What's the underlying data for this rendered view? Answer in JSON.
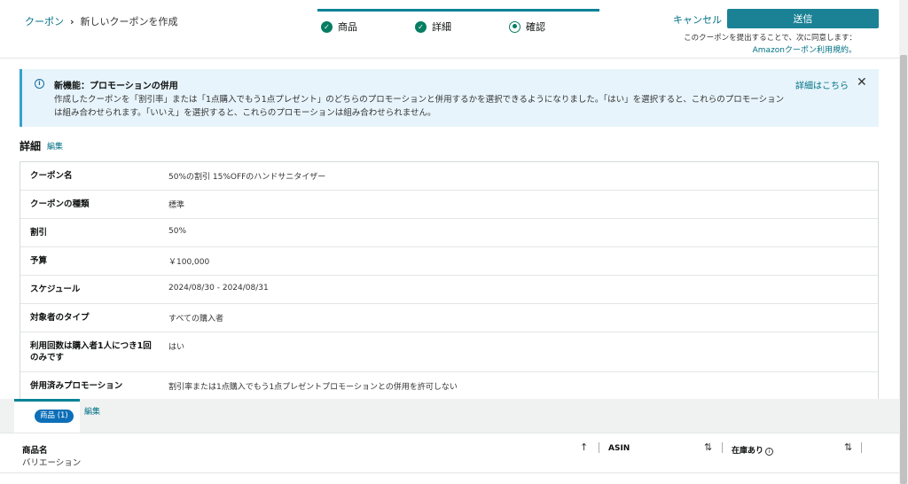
{
  "breadcrumb": {
    "root": "クーポン",
    "separator": "›",
    "current": "新しいクーポンを作成"
  },
  "steps": [
    {
      "label": "商品",
      "status": "complete"
    },
    {
      "label": "詳細",
      "status": "complete"
    },
    {
      "label": "確認",
      "status": "current"
    }
  ],
  "header": {
    "cancel_label": "キャンセル",
    "submit_label": "送信",
    "terms_text": "このクーポンを提出することで、次に同意します：",
    "terms_link": "Amazonクーポン利用規約。"
  },
  "alert": {
    "title": "新機能：プロモーションの併用",
    "body": "作成したクーポンを「割引率」または「1点購入でもう1点プレゼント」のどちらのプロモーションと併用するかを選択できるようになりました。「はい」を選択すると、これらのプロモーションは組み合わせられます。「いいえ」を選択すると、これらのプロモーションは組み合わせられません。",
    "more_link": "詳細はこちら",
    "close_glyph": "✕",
    "info_glyph": "i"
  },
  "details": {
    "title": "詳細",
    "edit_label": "編集",
    "rows": [
      {
        "label": "クーポン名",
        "value": "50%の割引 15%OFFのハンドサニタイザー"
      },
      {
        "label": "クーポンの種類",
        "value": "標準"
      },
      {
        "label": "割引",
        "value": "50%"
      },
      {
        "label": "予算",
        "value": "￥100,000"
      },
      {
        "label": "スケジュール",
        "value": "2024/08/30 - 2024/08/31"
      },
      {
        "label": "対象者のタイプ",
        "value": "すべての購入者"
      },
      {
        "label": "利用回数は購入者1人につき1回のみです",
        "value": "はい"
      },
      {
        "label": "併用済みプロモーション",
        "value": "割引率または1点購入でもう1点プレゼントプロモーションとの併用を許可しない"
      }
    ]
  },
  "products_tab": {
    "badge_label": "商品 (1)",
    "edit_label": "編集"
  },
  "product_table": {
    "col_name": "商品名",
    "col_variation": "バリエーション",
    "col_asin": "ASIN",
    "col_stock": "在庫あり",
    "sort_up": "↑",
    "sort_both": "⇅",
    "info_glyph": "i"
  }
}
